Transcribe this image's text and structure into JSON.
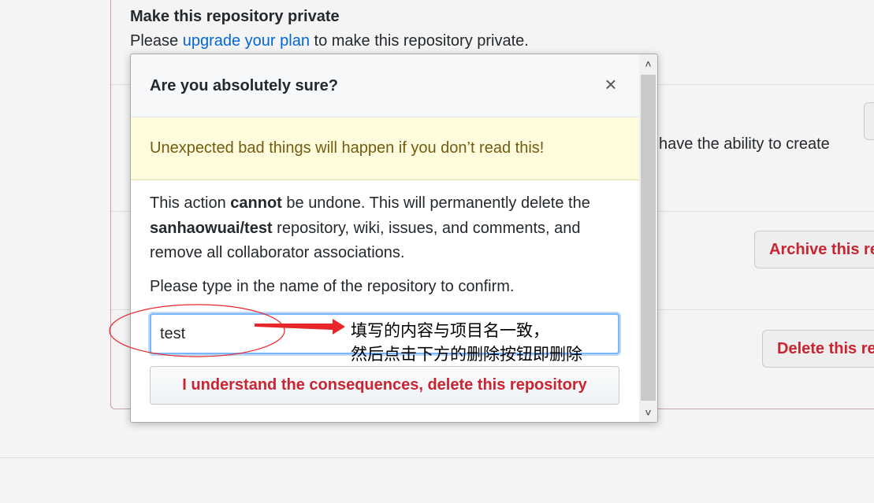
{
  "background": {
    "section_title": "Make this repository private",
    "section_desc_prefix": "Please ",
    "section_desc_link": "upgrade your plan",
    "section_desc_suffix": " to make this repository private.",
    "side_text": "have the ability to create",
    "archive_button": "Archive this re",
    "delete_button": "Delete this re"
  },
  "modal": {
    "title": "Are you absolutely sure?",
    "close_glyph": "×",
    "warning": "Unexpected bad things will happen if you don’t read this!",
    "body_part1": "This action ",
    "body_bold1": "cannot",
    "body_part2": " be undone. This will permanently delete the ",
    "body_bold2": "sanhaowuai/test",
    "body_part3": " repository, wiki, issues, and comments, and remove all collaborator associations.",
    "confirm_prompt": "Please type in the name of the repository to confirm.",
    "confirm_input_value": "test",
    "confirm_button": "I understand the consequences, delete this repository"
  },
  "annotation": {
    "line1": "填写的内容与项目名一致，",
    "line2": "然后点击下方的删除按钮即删除"
  },
  "colors": {
    "danger": "#cb2431",
    "link": "#0366d6",
    "warning_bg": "#fffbdd",
    "annotation_red": "#e8272a"
  }
}
